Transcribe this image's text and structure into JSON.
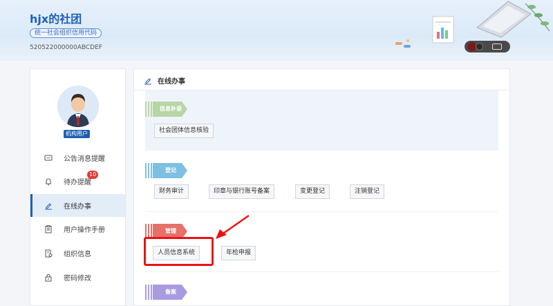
{
  "header": {
    "org_name": "hjx的社团",
    "code_label": "统一社会组织信用代码",
    "code_value": "520522000000ABCDEF"
  },
  "sidebar": {
    "user_role": "机构用户",
    "items": [
      {
        "label": "公告消息提醒",
        "icon": "message-icon"
      },
      {
        "label": "待办提醒",
        "icon": "bell-icon",
        "badge": "10"
      },
      {
        "label": "在线办事",
        "icon": "edit-icon",
        "active": true
      },
      {
        "label": "用户操作手册",
        "icon": "manual-icon"
      },
      {
        "label": "组织信息",
        "icon": "org-info-icon"
      },
      {
        "label": "密码修改",
        "icon": "lock-icon"
      }
    ]
  },
  "main": {
    "title": "在线办事",
    "sections": [
      {
        "label": "信息补录",
        "color": "#b8d5a6",
        "buttons": [
          "社会团体信息核验"
        ]
      },
      {
        "label": "登记",
        "color": "#7dc0e3",
        "buttons": [
          "财务审计",
          "印章与银行账号备案",
          "变更登记",
          "注销登记"
        ]
      },
      {
        "label": "管理",
        "color": "#e8706a",
        "buttons": [
          "人员信息系统",
          "年检申报"
        ]
      },
      {
        "label": "备案",
        "color": "#a99be0",
        "buttons": []
      }
    ]
  },
  "colors": {
    "accent": "#1f5fb3",
    "highlight": "#ee1111",
    "badge": "#e53935"
  }
}
